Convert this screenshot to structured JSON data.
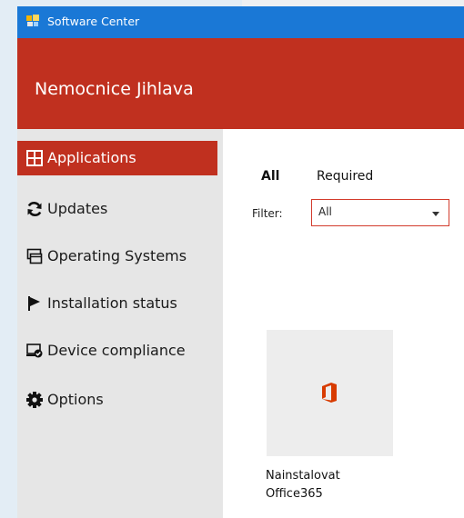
{
  "window": {
    "title": "Software Center"
  },
  "header": {
    "organization": "Nemocnice Jihlava"
  },
  "sidebar": {
    "items": [
      {
        "label": "Applications",
        "icon": "applications-icon",
        "active": true
      },
      {
        "label": "Updates",
        "icon": "refresh-icon"
      },
      {
        "label": "Operating Systems",
        "icon": "windows-icon"
      },
      {
        "label": "Installation status",
        "icon": "flag-icon"
      },
      {
        "label": "Device compliance",
        "icon": "device-compliance-icon"
      },
      {
        "label": "Options",
        "icon": "gear-icon"
      }
    ]
  },
  "main": {
    "tabs": [
      {
        "label": "All",
        "active": true
      },
      {
        "label": "Required"
      }
    ],
    "filter": {
      "label": "Filter:",
      "value": "All"
    },
    "apps": [
      {
        "name_line1": "Nainstalovat",
        "name_line2": "Office365",
        "icon": "office-icon"
      }
    ]
  },
  "colors": {
    "title_bar": "#1a78d6",
    "brand": "#c0301f",
    "sidebar_bg": "#e6e6e6",
    "tile_bg": "#ededed",
    "office_orange": "#d83b01"
  }
}
